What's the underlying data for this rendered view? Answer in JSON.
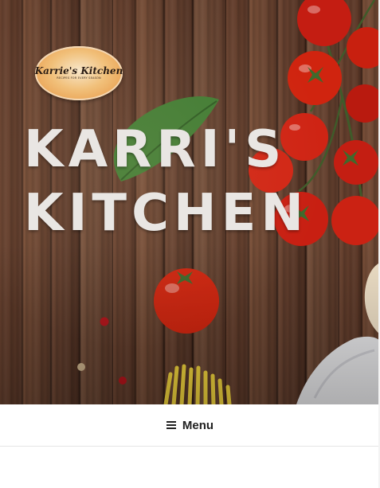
{
  "hero": {
    "logo": {
      "name": "Karrie's Kitchen",
      "tagline": "RECIPES FOR EVERY SEASON"
    },
    "site_title_line1": "KARRI'S",
    "site_title_line2": "KITCHEN",
    "text_color": "#e9e6e3"
  },
  "nav": {
    "menu_label": "Menu",
    "icon": "hamburger-icon"
  }
}
